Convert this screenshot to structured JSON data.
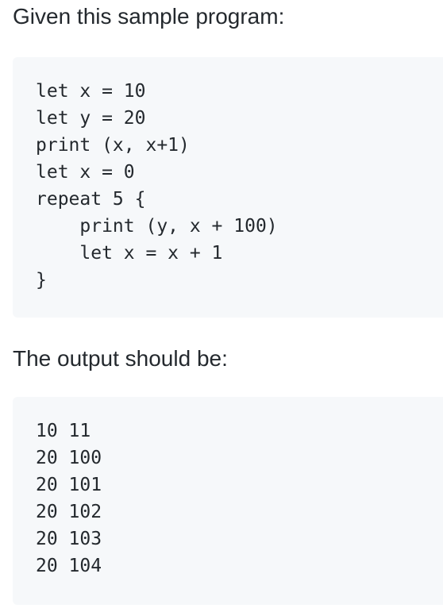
{
  "intro_text": "Given this sample program:",
  "program_lines": [
    "let x = 10",
    "let y = 20",
    "print (x, x+1)",
    "let x = 0",
    "repeat 5 {",
    "    print (y, x + 100)",
    "    let x = x + 1",
    "}"
  ],
  "output_intro_text": "The output should be:",
  "output_lines": [
    "10 11",
    "20 100",
    "20 101",
    "20 102",
    "20 103",
    "20 104"
  ]
}
